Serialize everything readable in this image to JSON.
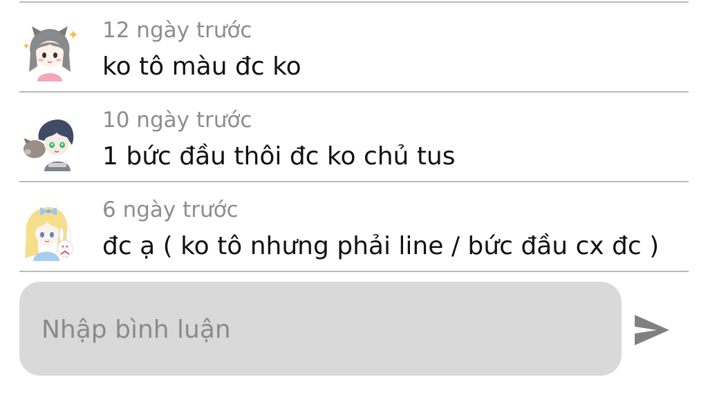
{
  "comments": [
    {
      "time": "12 ngày trước",
      "text": "ko tô màu đc ko",
      "avatar_icon": "anime-girl-cat-ears-avatar-icon"
    },
    {
      "time": "10 ngày trước",
      "text": "1 bức đầu thôi đc ko chủ tus",
      "avatar_icon": "anime-boy-boar-avatar-icon"
    },
    {
      "time": "6 ngày trước",
      "text": "đc ạ ( ko tô nhưng phải line / bức đầu cx đc )",
      "avatar_icon": "anime-girl-rabbit-avatar-icon"
    }
  ],
  "composer": {
    "placeholder": "Nhập bình luận",
    "value": "",
    "send_icon": "send-icon"
  },
  "colors": {
    "divider": "#b9b9b9",
    "timestamp": "#8d8d8d",
    "text": "#111111",
    "input_background": "#d9d9d9",
    "placeholder": "#8a8a8a",
    "send_icon": "#808080"
  }
}
